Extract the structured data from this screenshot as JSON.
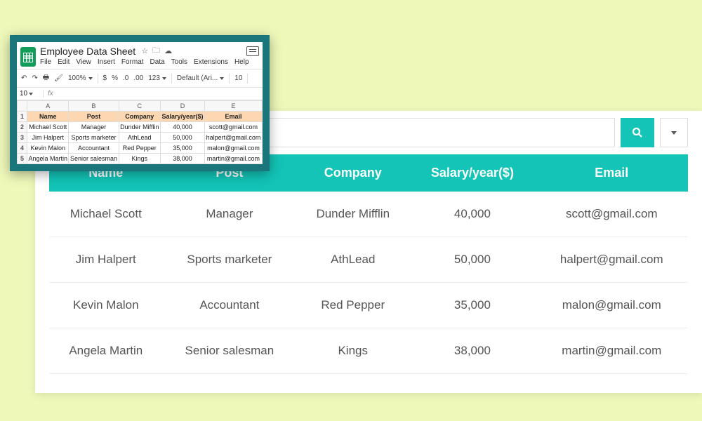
{
  "search": {
    "placeholder": ""
  },
  "table": {
    "headers": [
      "Name",
      "Post",
      "Company",
      "Salary/year($)",
      "Email"
    ],
    "rows": [
      [
        "Michael Scott",
        "Manager",
        "Dunder Mifflin",
        "40,000",
        "scott@gmail.com"
      ],
      [
        "Jim Halpert",
        "Sports marketer",
        "AthLead",
        "50,000",
        "halpert@gmail.com"
      ],
      [
        "Kevin Malon",
        "Accountant",
        "Red Pepper",
        "35,000",
        "malon@gmail.com"
      ],
      [
        "Angela Martin",
        "Senior salesman",
        "Kings",
        "38,000",
        "martin@gmail.com"
      ]
    ]
  },
  "sheet": {
    "title": "Employee Data Sheet",
    "title_icons": [
      "☆",
      "🗀",
      "☁"
    ],
    "menus": [
      "File",
      "Edit",
      "View",
      "Insert",
      "Format",
      "Data",
      "Tools",
      "Extensions",
      "Help"
    ],
    "toolbar": {
      "undo": "↶",
      "redo": "↷",
      "print": "🖶",
      "paint": "🖌",
      "zoom": "100%",
      "currency": "$",
      "percent": "%",
      "dec_dec": ".0",
      "dec_inc": ".00",
      "num_format": "123",
      "font": "Default (Ari...",
      "font_size": "10"
    },
    "cell_name": "10",
    "fx_label": "fx",
    "cols": [
      "A",
      "B",
      "C",
      "D",
      "E"
    ],
    "row_nums": [
      "1",
      "2",
      "3",
      "4",
      "5"
    ],
    "headers": [
      "Name",
      "Post",
      "Company",
      "Salary/year($)",
      "Email"
    ],
    "rows": [
      [
        "Michael Scott",
        "Manager",
        "Dunder Mifflin",
        "40,000",
        "scott@gmail.com"
      ],
      [
        "Jim Halpert",
        "Sports marketer",
        "AthLead",
        "50,000",
        "halpert@gmail.com"
      ],
      [
        "Kevin Malon",
        "Accountant",
        "Red Pepper",
        "35,000",
        "malon@gmail.com"
      ],
      [
        "Angela Martin",
        "Senior salesman",
        "Kings",
        "38,000",
        "martin@gmail.com"
      ]
    ]
  }
}
